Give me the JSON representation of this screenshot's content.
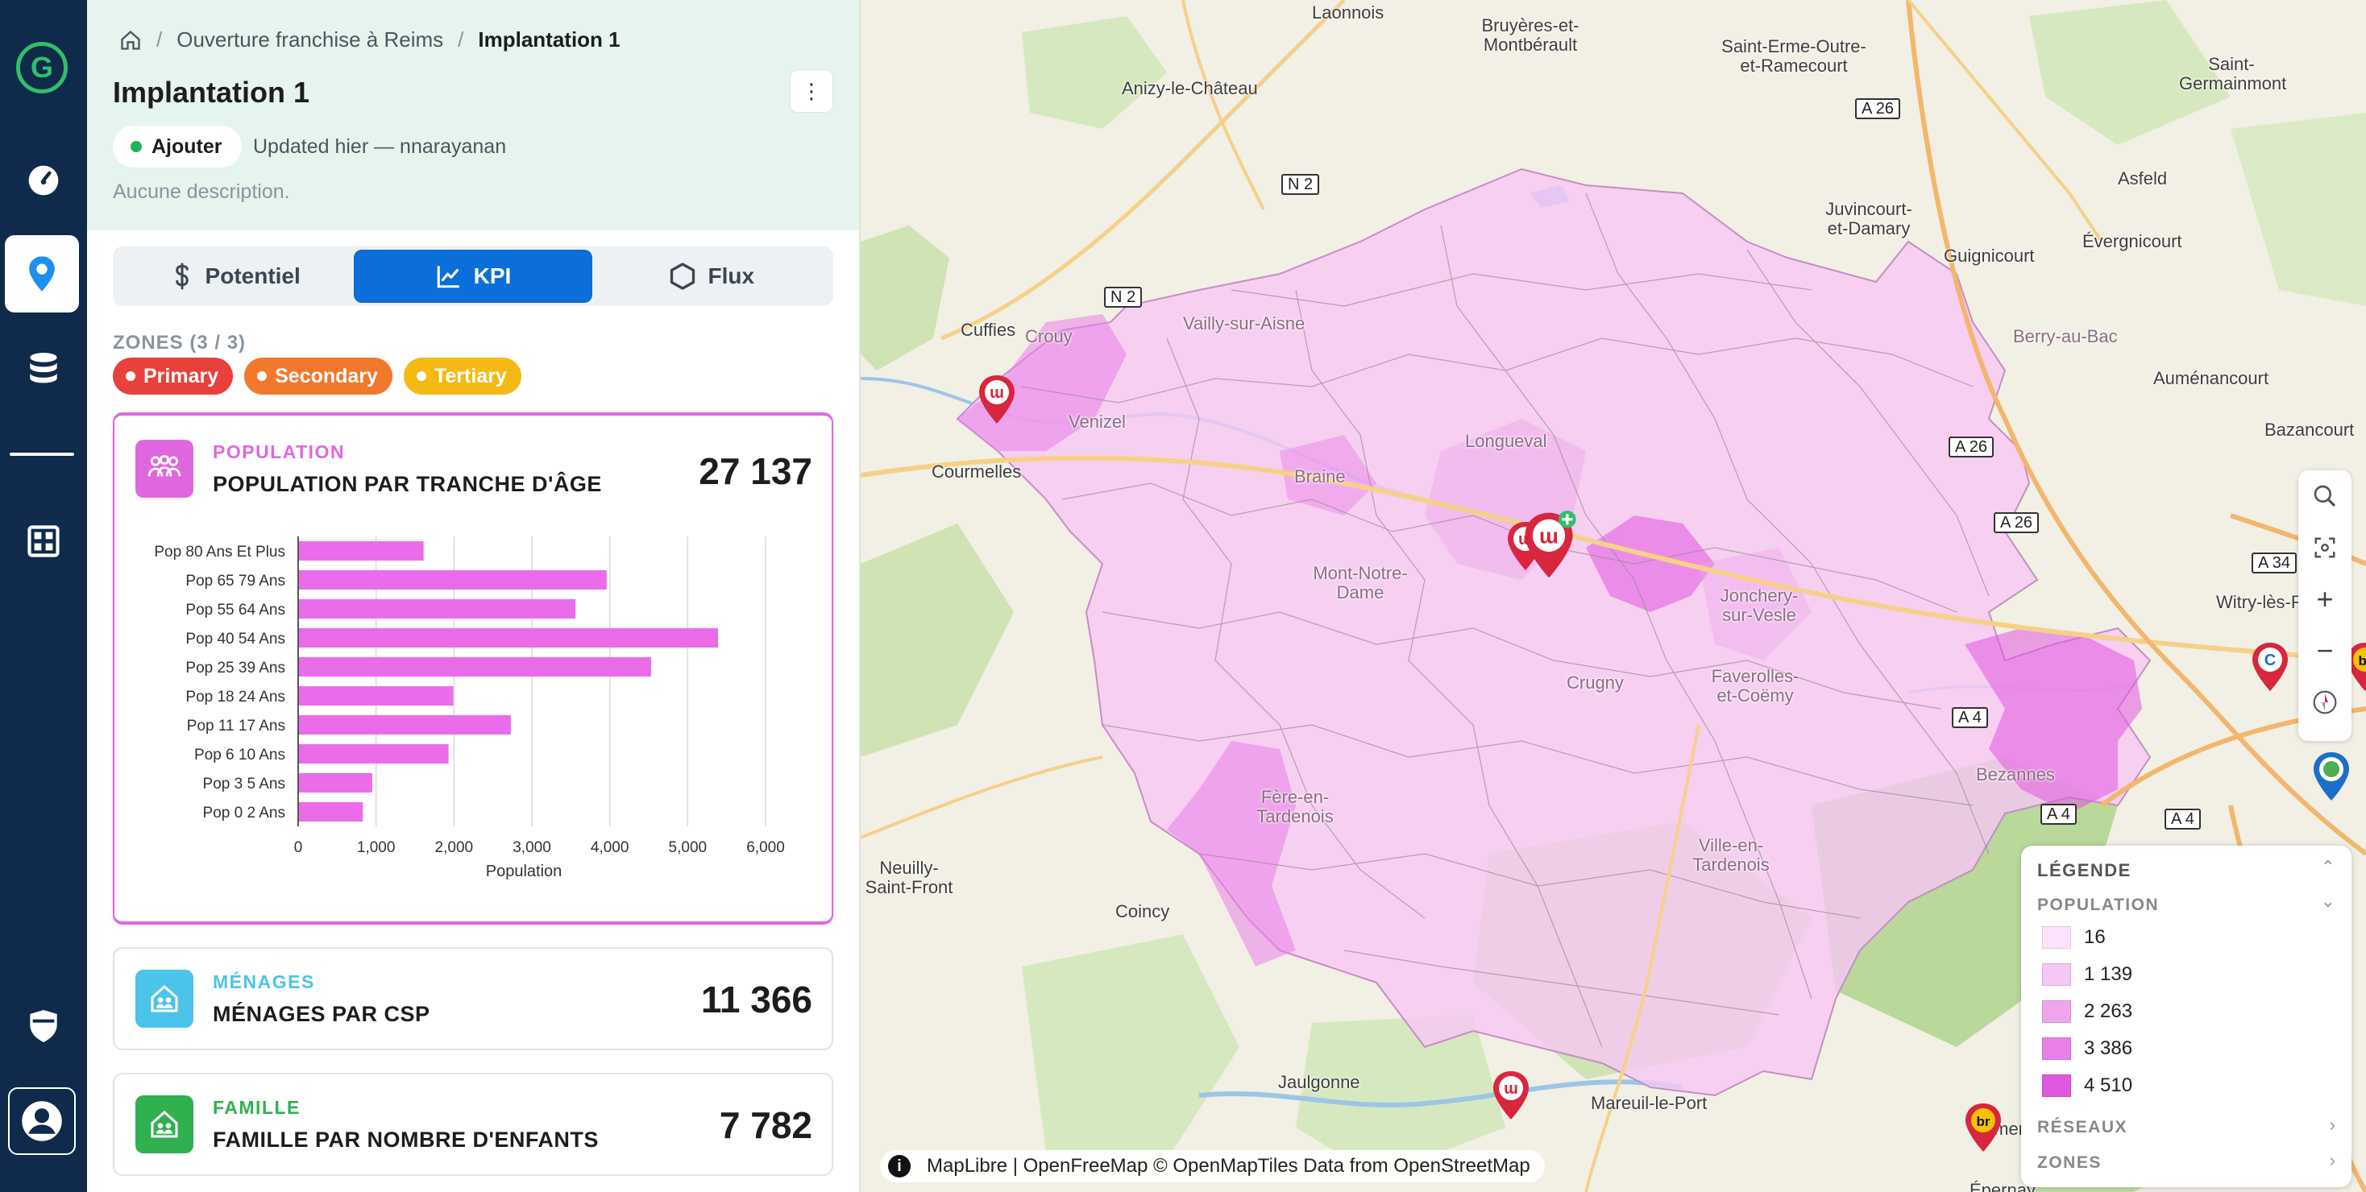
{
  "app": {
    "logo_letter": "G"
  },
  "breadcrumb": {
    "parent": "Ouverture franchise à Reims",
    "current": "Implantation 1"
  },
  "page": {
    "title": "Implantation 1",
    "status": "Ajouter",
    "updated": "Updated hier — nnarayanan",
    "description": "Aucune description."
  },
  "tabs": [
    {
      "label": "Potentiel",
      "icon": "dollar-icon"
    },
    {
      "label": "KPI",
      "icon": "chart-line-icon",
      "active": true
    },
    {
      "label": "Flux",
      "icon": "hexagon-icon"
    }
  ],
  "zones": {
    "title": "ZONES (3 / 3)",
    "chips": [
      {
        "label": "Primary",
        "color": "#e8413c"
      },
      {
        "label": "Secondary",
        "color": "#f2782b"
      },
      {
        "label": "Tertiary",
        "color": "#f5b915"
      }
    ]
  },
  "cards": [
    {
      "category": "POPULATION",
      "name": "POPULATION PAR TRANCHE D'ÂGE",
      "value": "27 137",
      "color": "#e066e0"
    },
    {
      "category": "MÉNAGES",
      "name": "MÉNAGES PAR CSP",
      "value": "11 366",
      "color": "#4cc3ea"
    },
    {
      "category": "FAMILLE",
      "name": "FAMILLE PAR NOMBRE D'ENFANTS",
      "value": "7 782",
      "color": "#2fb14f"
    }
  ],
  "chart_data": {
    "type": "bar",
    "orientation": "horizontal",
    "categories": [
      "Pop 80 Ans Et Plus",
      "Pop 65 79 Ans",
      "Pop 55 64 Ans",
      "Pop 40 54 Ans",
      "Pop 25 39 Ans",
      "Pop 18 24 Ans",
      "Pop 11 17 Ans",
      "Pop 6 10 Ans",
      "Pop 3 5 Ans",
      "Pop 0 2 Ans"
    ],
    "values": [
      1600,
      3950,
      3550,
      5380,
      4520,
      1980,
      2720,
      1920,
      940,
      820
    ],
    "xlabel": "Population",
    "xlim": [
      0,
      6000
    ],
    "xticks": [
      "0",
      "1,000",
      "2,000",
      "3,000",
      "4,000",
      "5,000",
      "6,000"
    ],
    "color": "#ea6cea",
    "grid": true
  },
  "map": {
    "labels": [
      "Laonnois",
      "Bruyères-et-Montbérault",
      "Saint-Erme-Outre-et-Ramecourt",
      "Saint-Germainmont",
      "Anizy-le-Château",
      "Asfeld",
      "Juvincourt-et-Damary",
      "Évergnicourt",
      "Guignicourt",
      "Cuffies",
      "Crouy",
      "Vailly-sur-Aisne",
      "Berry-au-Bac",
      "Auménancourt",
      "Venizel",
      "Bazancourt",
      "Courmelles",
      "Longueval",
      "Braine",
      "Mont-Notre-Dame",
      "Jonchery-sur-Vesle",
      "Witry-lès-Reims",
      "Crugny",
      "Faverolles-et-Coëmy",
      "Bezannes",
      "Fère-en-Tardenois",
      "Ville-en-Tardenois",
      "Neuilly-Saint-Front",
      "Coincy",
      "Jaulgonne",
      "Mareuil-le-Port",
      "Damery",
      "Épernay"
    ],
    "roads": [
      "A 26",
      "N 2",
      "N 2",
      "A 26",
      "A 26",
      "A 34",
      "A 4",
      "A 4",
      "A 4"
    ],
    "attribution": {
      "info": "i",
      "text": "MapLibre | OpenFreeMap © OpenMapTiles Data from OpenStreetMap"
    }
  },
  "map_controls": [
    {
      "icon": "search-icon"
    },
    {
      "icon": "focus-icon"
    },
    {
      "label": "+",
      "icon": "zoom-in-icon"
    },
    {
      "label": "−",
      "icon": "zoom-out-icon"
    },
    {
      "icon": "compass-icon"
    }
  ],
  "legend": {
    "title": "LÉGENDE",
    "population": {
      "title": "POPULATION",
      "items": [
        {
          "value": "16",
          "color": "#fbe4fb"
        },
        {
          "value": "1 139",
          "color": "#f6c7f4"
        },
        {
          "value": "2 263",
          "color": "#f0a4ee"
        },
        {
          "value": "3 386",
          "color": "#ea7fe8"
        },
        {
          "value": "4 510",
          "color": "#e257e0"
        }
      ]
    },
    "reseaux": "RÉSEAUX",
    "zones": "ZONES"
  }
}
